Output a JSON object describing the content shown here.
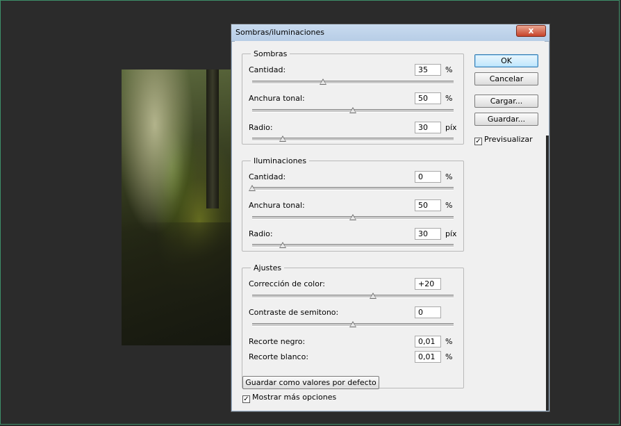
{
  "window": {
    "title": "Sombras/iluminaciones",
    "close_glyph": "x"
  },
  "buttons": {
    "ok": "OK",
    "cancel": "Cancelar",
    "load": "Cargar...",
    "save": "Guardar...",
    "save_defaults": "Guardar como valores por defecto"
  },
  "preview": {
    "label": "Previsualizar",
    "checked": true
  },
  "more_options": {
    "label": "Mostrar más opciones",
    "checked": true
  },
  "shadows": {
    "legend": "Sombras",
    "amount": {
      "label": "Cantidad:",
      "value": "35",
      "unit": "%",
      "slider": 0.35
    },
    "tonal_width": {
      "label": "Anchura tonal:",
      "value": "50",
      "unit": "%",
      "slider": 0.5
    },
    "radius": {
      "label": "Radio:",
      "value": "30",
      "unit": "píx",
      "slider": 0.15
    }
  },
  "highlights": {
    "legend": "Iluminaciones",
    "amount": {
      "label": "Cantidad:",
      "value": "0",
      "unit": "%",
      "slider": 0.0
    },
    "tonal_width": {
      "label": "Anchura tonal:",
      "value": "50",
      "unit": "%",
      "slider": 0.5
    },
    "radius": {
      "label": "Radio:",
      "value": "30",
      "unit": "píx",
      "slider": 0.15
    }
  },
  "adjustments": {
    "legend": "Ajustes",
    "color_correction": {
      "label": "Corrección de color:",
      "value": "+20",
      "slider": 0.6
    },
    "midtone_contrast": {
      "label": "Contraste de semitono:",
      "value": "0",
      "slider": 0.5
    },
    "black_clip": {
      "label": "Recorte negro:",
      "value": "0,01",
      "unit": "%"
    },
    "white_clip": {
      "label": "Recorte blanco:",
      "value": "0,01",
      "unit": "%"
    }
  },
  "check_glyph": "✓"
}
